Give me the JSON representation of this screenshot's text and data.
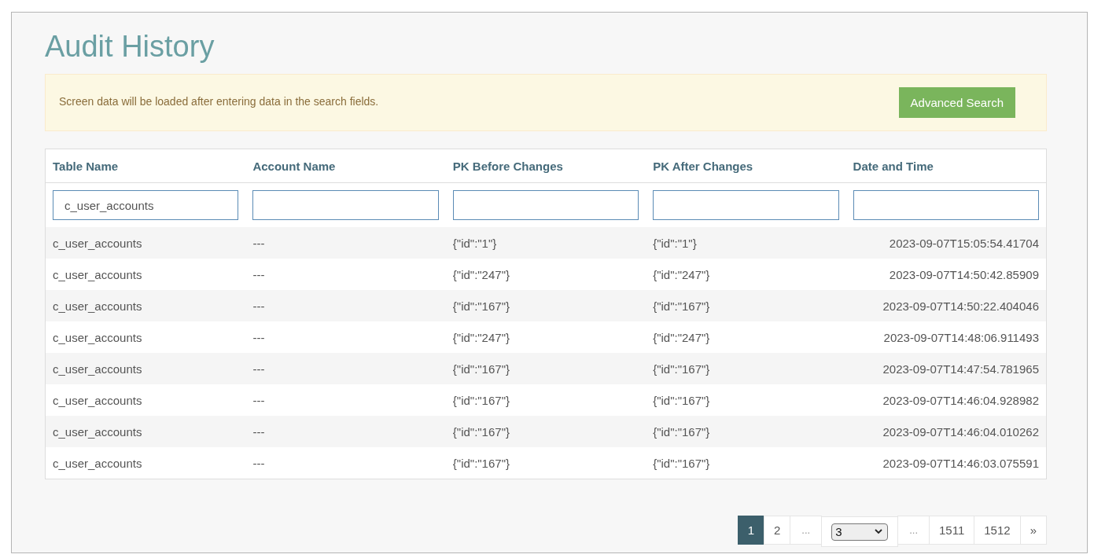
{
  "title": "Audit History",
  "alert": {
    "message": "Screen data will be loaded after entering data in the search fields.",
    "button": "Advanced Search"
  },
  "table": {
    "columns": [
      "Table Name",
      "Account Name",
      "PK Before Changes",
      "PK After Changes",
      "Date and Time"
    ],
    "table_name_filter": "c_user_accounts",
    "rows": [
      [
        "c_user_accounts",
        "---",
        "{\"id\":\"1\"}",
        "{\"id\":\"1\"}",
        "2023-09-07T15:05:54.41704"
      ],
      [
        "c_user_accounts",
        "---",
        "{\"id\":\"247\"}",
        "{\"id\":\"247\"}",
        "2023-09-07T14:50:42.85909"
      ],
      [
        "c_user_accounts",
        "---",
        "{\"id\":\"167\"}",
        "{\"id\":\"167\"}",
        "2023-09-07T14:50:22.404046"
      ],
      [
        "c_user_accounts",
        "---",
        "{\"id\":\"247\"}",
        "{\"id\":\"247\"}",
        "2023-09-07T14:48:06.911493"
      ],
      [
        "c_user_accounts",
        "---",
        "{\"id\":\"167\"}",
        "{\"id\":\"167\"}",
        "2023-09-07T14:47:54.781965"
      ],
      [
        "c_user_accounts",
        "---",
        "{\"id\":\"167\"}",
        "{\"id\":\"167\"}",
        "2023-09-07T14:46:04.928982"
      ],
      [
        "c_user_accounts",
        "---",
        "{\"id\":\"167\"}",
        "{\"id\":\"167\"}",
        "2023-09-07T14:46:04.010262"
      ],
      [
        "c_user_accounts",
        "---",
        "{\"id\":\"167\"}",
        "{\"id\":\"167\"}",
        "2023-09-07T14:46:03.075591"
      ]
    ]
  },
  "pagination": [
    {
      "kind": "page",
      "label": "1",
      "selected": true
    },
    {
      "kind": "page",
      "label": "2",
      "selected": false
    },
    {
      "kind": "ellipsis",
      "label": "...",
      "selected": false
    },
    {
      "kind": "select",
      "label": "3",
      "selected": false
    },
    {
      "kind": "ellipsis",
      "label": "...",
      "selected": false
    },
    {
      "kind": "page",
      "label": "1511",
      "selected": false
    },
    {
      "kind": "page",
      "label": "1512",
      "selected": false
    },
    {
      "kind": "next",
      "label": "»",
      "selected": false
    }
  ]
}
